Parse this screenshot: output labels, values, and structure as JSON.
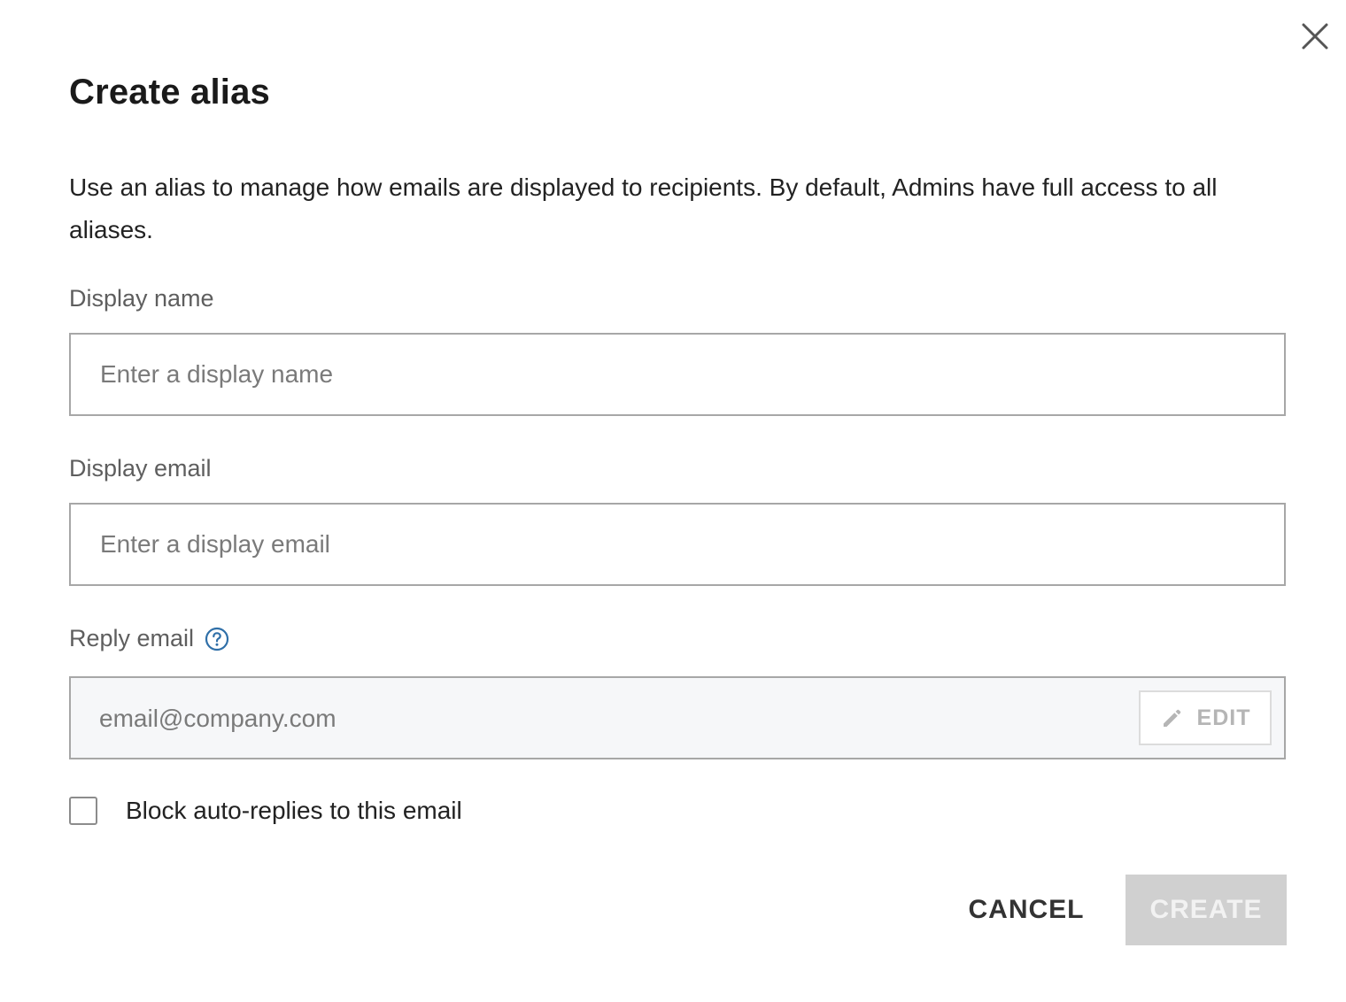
{
  "dialog": {
    "title": "Create alias",
    "description": "Use an alias to manage how emails are displayed to recipients. By default, Admins have full access to all aliases.",
    "close_icon": "close-icon"
  },
  "fields": {
    "display_name": {
      "label": "Display name",
      "value": "",
      "placeholder": "Enter a display name"
    },
    "display_email": {
      "label": "Display email",
      "value": "",
      "placeholder": "Enter a display email"
    },
    "reply_email": {
      "label": "Reply email",
      "help_icon": "question-circle-icon",
      "value": "email@company.com",
      "edit_label": "EDIT",
      "edit_icon": "pencil-icon"
    }
  },
  "block_auto_replies": {
    "label": "Block auto-replies to this email",
    "checked": false
  },
  "actions": {
    "cancel_label": "CANCEL",
    "create_label": "CREATE",
    "create_enabled": false
  },
  "colors": {
    "accent": "#2f6fa8",
    "disabled_button": "#d0d0d0",
    "readonly_background": "#f6f7f9",
    "border": "#a7a7a7"
  }
}
